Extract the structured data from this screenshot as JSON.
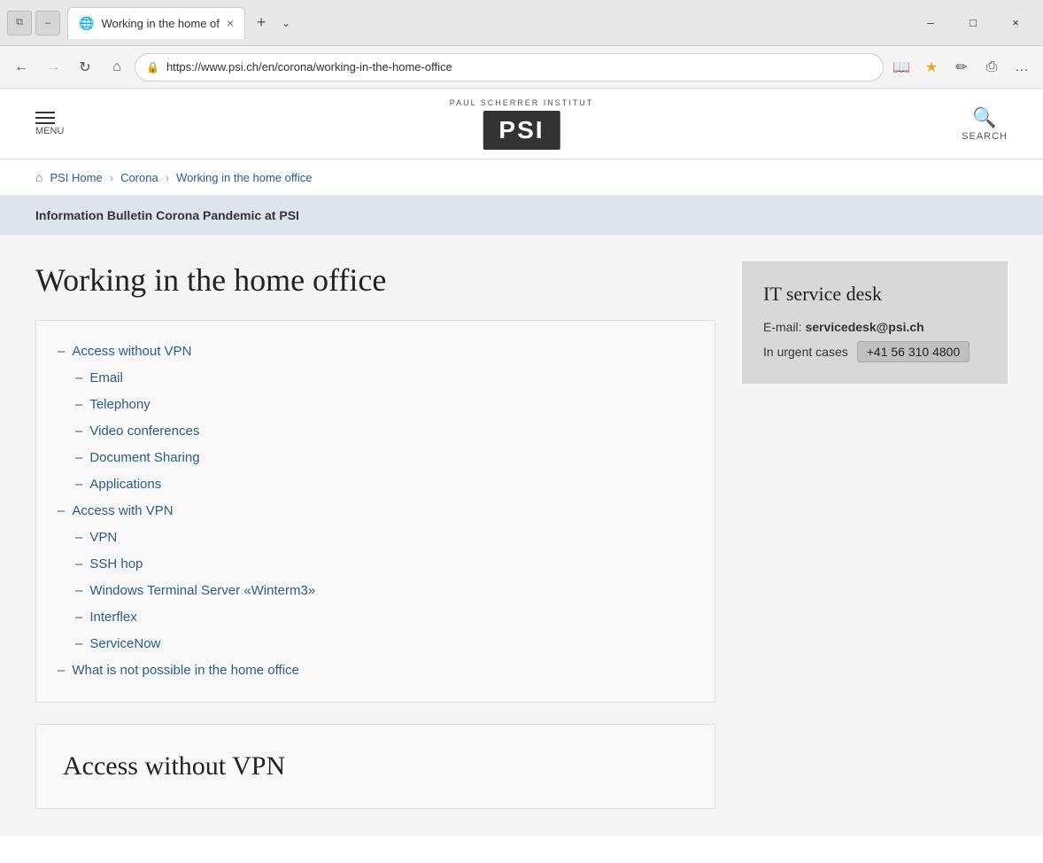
{
  "browser": {
    "titlebar": {
      "tab_favicon": "🌐",
      "tab_title": "Working in the home of",
      "tab_close": "×",
      "new_tab_icon": "+",
      "dropdown_icon": "⌄",
      "win_min": "–",
      "win_max": "□",
      "win_close": "×"
    },
    "navbar": {
      "back_icon": "←",
      "forward_icon": "→",
      "refresh_icon": "↻",
      "home_icon": "⌂",
      "lock_icon": "🔒",
      "url": "https://www.psi.ch/en/corona/working-in-the-home-office",
      "reader_icon": "📖",
      "star_icon": "★",
      "pen_icon": "✏",
      "share_icon": "⎙",
      "more_icon": "…"
    }
  },
  "site": {
    "menu_label": "MENU",
    "logo_institution": "PAUL SCHERRER INSTITUT",
    "logo_text": "PSI",
    "search_label": "SEARCH"
  },
  "breadcrumb": {
    "home_icon": "⌂",
    "items": [
      {
        "label": "PSI Home",
        "href": "#"
      },
      {
        "label": "Corona",
        "href": "#"
      },
      {
        "label": "Working in the home office",
        "href": "#"
      }
    ],
    "sep": "›"
  },
  "banner": {
    "text": "Information Bulletin Corona Pandemic at PSI"
  },
  "page": {
    "title": "Working in the home office"
  },
  "toc": {
    "items": [
      {
        "level": 1,
        "label": "Access without VPN",
        "href": "#"
      },
      {
        "level": 2,
        "label": "Email",
        "href": "#"
      },
      {
        "level": 2,
        "label": "Telephony",
        "href": "#"
      },
      {
        "level": 2,
        "label": "Video conferences",
        "href": "#"
      },
      {
        "level": 2,
        "label": "Document Sharing",
        "href": "#"
      },
      {
        "level": 2,
        "label": "Applications",
        "href": "#"
      },
      {
        "level": 1,
        "label": "Access with VPN",
        "href": "#"
      },
      {
        "level": 2,
        "label": "VPN",
        "href": "#"
      },
      {
        "level": 2,
        "label": "SSH hop",
        "href": "#"
      },
      {
        "level": 2,
        "label": "Windows Terminal Server «Winterm3»",
        "href": "#"
      },
      {
        "level": 2,
        "label": "Interflex",
        "href": "#"
      },
      {
        "level": 2,
        "label": "ServiceNow",
        "href": "#"
      },
      {
        "level": 1,
        "label": "What is not possible in the home office",
        "href": "#"
      }
    ]
  },
  "sidebar": {
    "it_box": {
      "title": "IT service desk",
      "email_label": "E-mail:",
      "email": "servicedesk@psi.ch",
      "urgent_label": "In urgent cases",
      "phone": "+41 56 310 4800"
    }
  },
  "section_access_no_vpn": {
    "title": "Access without VPN"
  }
}
